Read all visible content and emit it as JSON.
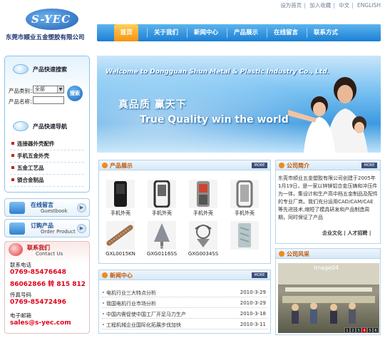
{
  "header": {
    "logo_text": "S-YEC",
    "company_name": "东莞市顺业五金塑胶有限公司",
    "top_links": [
      "设为首页",
      "加入收藏",
      "中文",
      "ENGLISH"
    ]
  },
  "nav": {
    "items": [
      "首页",
      "关于我们",
      "新闻中心",
      "产品展示",
      "在线留言",
      "联系方式"
    ],
    "active_index": 0
  },
  "banner": {
    "welcome": "Welcome to Dongguan Shun Metal & Plastic Industry Co., Ltd.",
    "slogan_cn": "真品质 赢天下",
    "slogan_en": "True Quality win the world"
  },
  "search": {
    "title": "产品快速搜索",
    "category_label": "产品类别：",
    "category_value": "全部",
    "name_label": "产品名称：",
    "name_value": "",
    "button": "搜索"
  },
  "product_nav": {
    "title": "产品快速导航",
    "items": [
      "连接器外壳配件",
      "手机五金外壳",
      "五金工艺品",
      "锁合金制品"
    ]
  },
  "side_buttons": [
    {
      "title": "在线留言",
      "subtitle": "Guestbook"
    },
    {
      "title": "订购产品",
      "subtitle": "Order Product"
    }
  ],
  "contact": {
    "title": "联系我们",
    "subtitle": "Contact Us",
    "phone_label": "联系电话",
    "phone1": "0769-85476648",
    "phone2": "86062866 转  815 812",
    "fax_label": "传真号码",
    "fax": "0769-85472496",
    "email_label": "电子邮箱",
    "email": "sales@s-yec.com"
  },
  "products": {
    "title": "产品展示",
    "more": "MORE",
    "items": [
      {
        "caption": "手机外壳"
      },
      {
        "caption": "手机外壳"
      },
      {
        "caption": "手机外壳"
      },
      {
        "caption": "手机外壳"
      },
      {
        "caption": "GXL0015KN"
      },
      {
        "caption": "GXG0116SS"
      },
      {
        "caption": "GXG0034SS"
      },
      {
        "caption": ""
      }
    ]
  },
  "news": {
    "title": "新闻中心",
    "more": "MORE",
    "items": [
      {
        "title": "电机行业三大特点分析",
        "date": "2010-3-29"
      },
      {
        "title": "我国电机行业市场分析",
        "date": "2010-3-29"
      },
      {
        "title": "中国内需促使中国工厂开足马力生产",
        "date": "2010-3-18"
      },
      {
        "title": "工程机械企业国际化拓展步伐加快",
        "date": "2010-3-11"
      }
    ]
  },
  "intro": {
    "title": "公司简介",
    "more": "MORE",
    "text": "东莞市顺业五金塑胶有限公司创建于2005年1月19日，是一家以锌镁铝合金压铸和冲压件为一体，集设计和生产高中档五金制品及配件的专业厂商。我们充分运用CAD/CAM/CAE等先进技术,缩短了模具研发和产品制造周期，同时保证了产品",
    "links": "企业文化 | 人才招聘 |"
  },
  "style_panel": {
    "title": "公司风采",
    "image_label": "Image04",
    "pages": [
      "1",
      "2",
      "3",
      "4",
      "5",
      "6"
    ]
  },
  "colors": {
    "nav_blue": "#1a7fd4",
    "nav_active": "#f59314",
    "accent_red": "#e0001b",
    "title_orange": "#c35600"
  }
}
